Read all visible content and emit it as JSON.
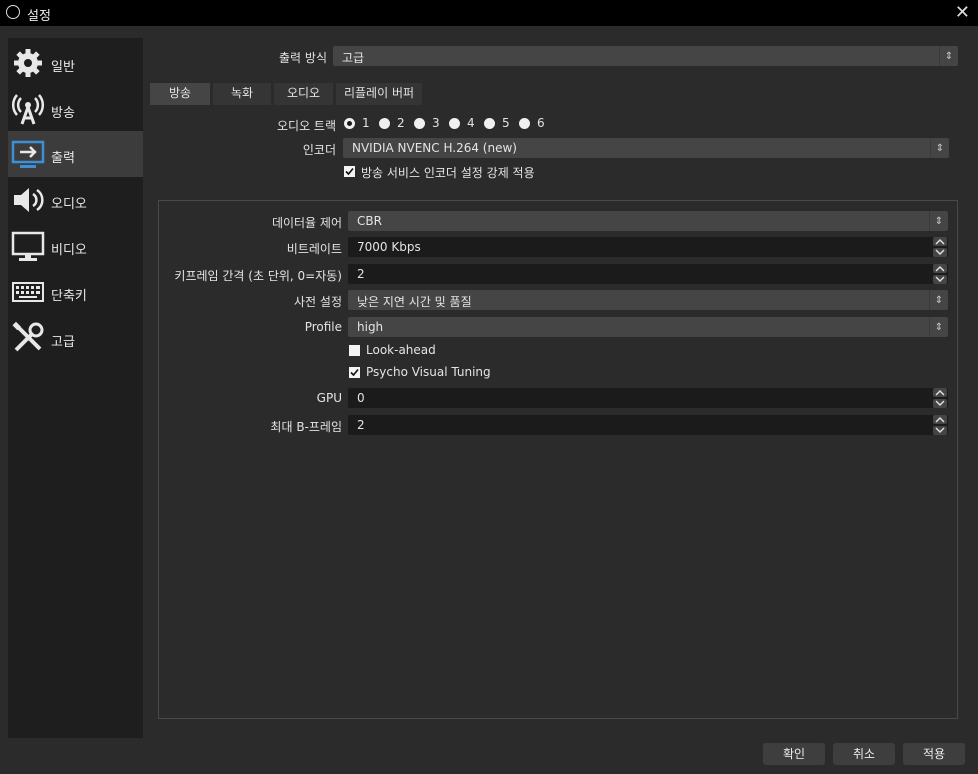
{
  "window": {
    "title": "설정"
  },
  "sidebar": {
    "items": [
      {
        "label": "일반",
        "icon": "gear-icon"
      },
      {
        "label": "방송",
        "icon": "broadcast-icon"
      },
      {
        "label": "출력",
        "icon": "output-monitor-icon",
        "active": true
      },
      {
        "label": "오디오",
        "icon": "speaker-icon"
      },
      {
        "label": "비디오",
        "icon": "monitor-icon"
      },
      {
        "label": "단축키",
        "icon": "keyboard-icon"
      },
      {
        "label": "고급",
        "icon": "tools-icon"
      }
    ]
  },
  "output_mode": {
    "label": "출력 방식",
    "value": "고급"
  },
  "tabs": [
    {
      "label": "방송",
      "active": true
    },
    {
      "label": "녹화"
    },
    {
      "label": "오디오"
    },
    {
      "label": "리플레이 버퍼"
    }
  ],
  "audio_track": {
    "label": "오디오 트랙",
    "options": [
      "1",
      "2",
      "3",
      "4",
      "5",
      "6"
    ],
    "selected": "1"
  },
  "encoder": {
    "label": "인코더",
    "value": "NVIDIA NVENC H.264 (new)"
  },
  "enforce": {
    "label": "방송 서비스 인코더 설정 강제 적용",
    "checked": true
  },
  "encoder_settings": {
    "rate_control": {
      "label": "데이터율 제어",
      "value": "CBR"
    },
    "bitrate": {
      "label": "비트레이트",
      "value": "7000 Kbps"
    },
    "keyframe": {
      "label": "키프레임 간격 (초 단위, 0=자동)",
      "value": "2"
    },
    "preset": {
      "label": "사전 설정",
      "value": "낮은 지연 시간 및 품질"
    },
    "profile": {
      "label": "Profile",
      "value": "high"
    },
    "lookahead": {
      "label": "Look-ahead",
      "checked": false
    },
    "psycho": {
      "label": "Psycho Visual Tuning",
      "checked": true
    },
    "gpu": {
      "label": "GPU",
      "value": "0"
    },
    "bframes": {
      "label": "최대 B-프레임",
      "value": "2"
    }
  },
  "buttons": {
    "ok": "확인",
    "cancel": "취소",
    "apply": "적용"
  }
}
